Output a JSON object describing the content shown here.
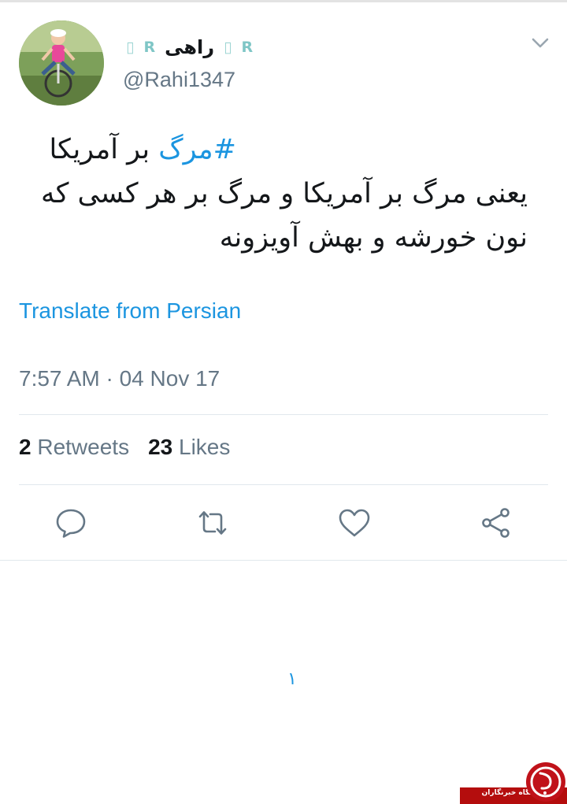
{
  "user": {
    "display_name": "راهی",
    "handle": "@Rahi1347",
    "name_badges": [
      "R",
      "R"
    ],
    "avatar": "avatar-photo"
  },
  "tweet": {
    "hashtag": "#مرگ",
    "line1_rest": " بر آمریکا",
    "line2": "یعنی مرگ بر آمریکا و مرگ بر هر کسی که",
    "line3": "نون خورشه و بهش آویزونه"
  },
  "translate_label": "Translate from Persian",
  "timestamp": "7:57 AM · 04 Nov 17",
  "stats": {
    "retweets_count": "2",
    "retweets_label": "Retweets",
    "likes_count": "23",
    "likes_label": "Likes"
  },
  "actions": [
    "reply-icon",
    "retweet-icon",
    "like-icon",
    "share-icon"
  ],
  "stray_mark": "١",
  "watermark": {
    "text": "باشگاه خبرنگاران",
    "logo": "watermark-logo"
  },
  "colors": {
    "link": "#1b95e0",
    "text": "#14171a",
    "muted": "#657786",
    "divider": "#e1e8ed",
    "watermark": "#b40d0d"
  }
}
